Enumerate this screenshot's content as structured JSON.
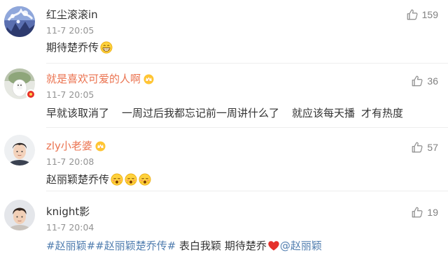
{
  "comments": [
    {
      "username": "红尘滚滚in",
      "time": "11-7 20:05",
      "text": "期待楚乔传",
      "likes": "159"
    },
    {
      "username": "就是喜欢可爱的人啊",
      "time": "11-7 20:05",
      "text_parts": [
        "早就该取消了",
        "一周过后我都忘记前一周讲什么了",
        "就应该每天播",
        "才有热度"
      ],
      "likes": "36"
    },
    {
      "username": "zly小老婆",
      "time": "11-7 20:08",
      "text": "赵丽颖楚乔传",
      "likes": "57"
    },
    {
      "username": "knight影",
      "time": "11-7 20:04",
      "tag1": "#赵丽颖#",
      "tag2": "#赵丽颖楚乔传#",
      "text": " 表白我颖 期待楚乔",
      "mention": "@赵丽颖",
      "likes": "19"
    }
  ],
  "colors": {
    "link": "#507daf",
    "vip_name": "#eb7350",
    "time": "#939393",
    "text": "#333333"
  },
  "icons": {
    "like": "thumbs-up-icon",
    "grin": "grinning-emoji-icon",
    "shy": "shy-emoji-icon",
    "heart": "red-heart-icon",
    "vip": "crown-badge-icon"
  }
}
